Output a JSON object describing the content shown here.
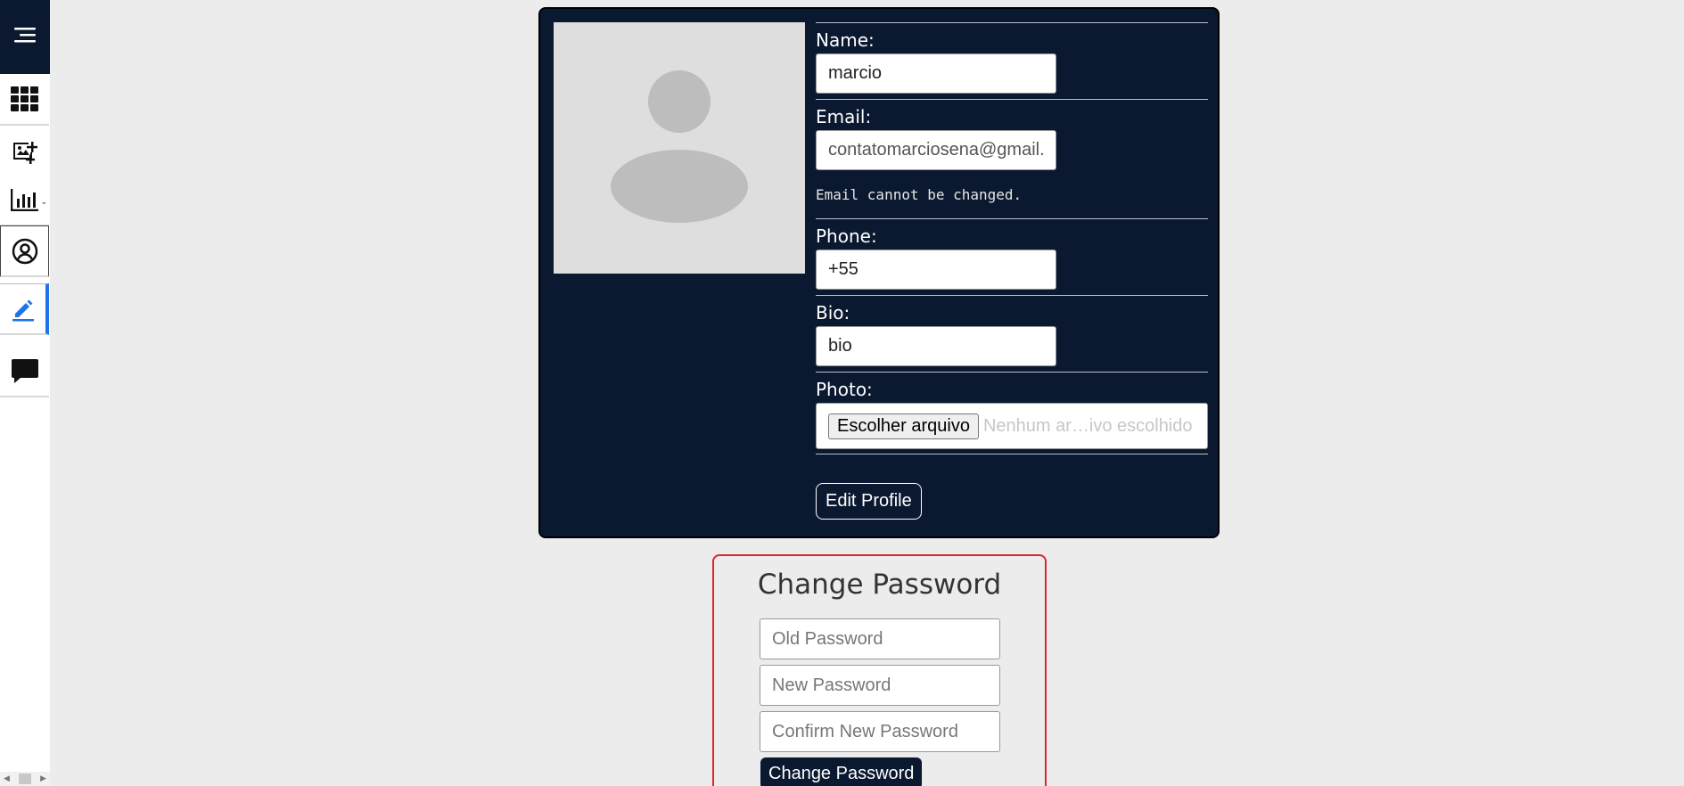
{
  "sidebar": {
    "items": [
      {
        "icon": "menu-icon"
      },
      {
        "icon": "grid-icon"
      },
      {
        "icon": "add-image-icon"
      },
      {
        "icon": "bar-chart-icon",
        "has_dropdown": true
      },
      {
        "icon": "user-circle-icon"
      },
      {
        "icon": "edit-icon",
        "active": true
      },
      {
        "icon": "chat-icon"
      }
    ]
  },
  "profile": {
    "name_label": "Name:",
    "name_value": "marcio",
    "email_label": "Email:",
    "email_value": "contatomarciosena@gmail.com",
    "email_note": "Email cannot be changed.",
    "phone_label": "Phone:",
    "phone_value": "+55",
    "bio_label": "Bio:",
    "bio_value": "bio",
    "photo_label": "Photo:",
    "file_button": "Escolher arquivo",
    "file_status": "Nenhum ar…ivo escolhido",
    "edit_button": "Edit Profile"
  },
  "password": {
    "title": "Change Password",
    "old_placeholder": "Old Password",
    "new_placeholder": "New Password",
    "confirm_placeholder": "Confirm New Password",
    "button": "Change Password"
  },
  "colors": {
    "navy": "#0b1930",
    "accent_blue": "#1e74e8",
    "border_red": "#e0242e",
    "background": "#ececec"
  }
}
